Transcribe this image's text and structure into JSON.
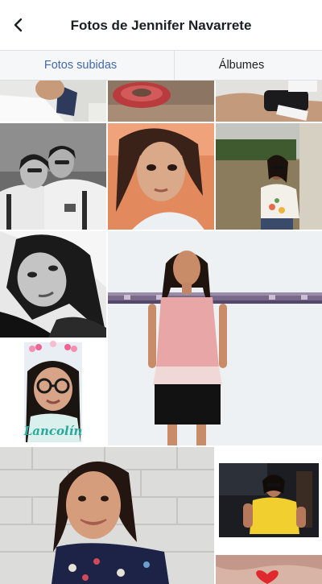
{
  "header": {
    "title": "Fotos de Jennifer Navarrete",
    "back_icon": "chevron-left-icon"
  },
  "tabs": [
    {
      "label": "Fotos subidas",
      "active": true
    },
    {
      "label": "Álbumes",
      "active": false
    }
  ],
  "colors": {
    "accent": "#4267b2",
    "text": "#1c1e21",
    "tab_bg": "#f6f7f9",
    "border": "#dddfe2"
  },
  "photos": {
    "sticker_text": "Lancolín"
  }
}
